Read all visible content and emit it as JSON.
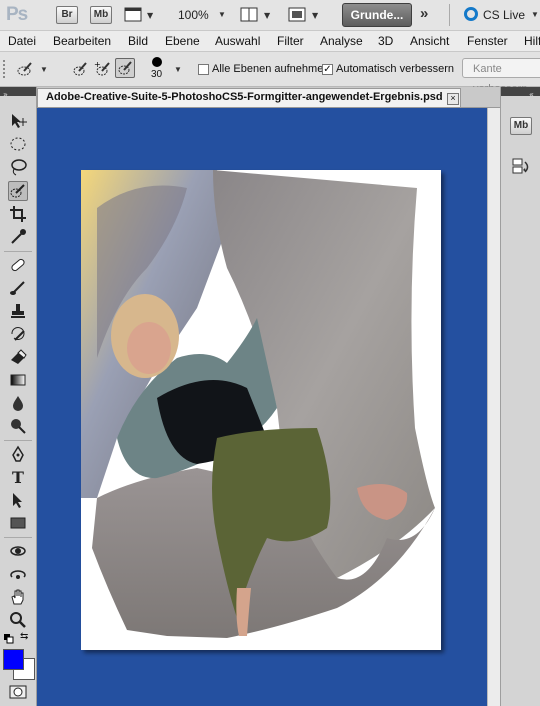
{
  "app": {
    "logo": "Ps",
    "bridge_label": "Br",
    "minibridge_label": "Mb",
    "zoom": "100%",
    "workspace_label": "Grunde...",
    "cslive_label": "CS Live"
  },
  "menu": [
    "Datei",
    "Bearbeiten",
    "Bild",
    "Ebene",
    "Auswahl",
    "Filter",
    "Analyse",
    "3D",
    "Ansicht",
    "Fenster",
    "Hilfe"
  ],
  "options": {
    "brush_size": "30",
    "sample_all_layers": "Alle Ebenen aufnehmen",
    "sample_all_layers_checked": false,
    "auto_enhance": "Automatisch verbessern",
    "auto_enhance_checked": true,
    "refine_edge": "Kante verbessern"
  },
  "document": {
    "tab_title": "Adobe-Creative-Suite-5-PhotoshoCS5-Formgitter-angewendet-Ergebnis.psd",
    "close_symbol": "×"
  },
  "colors": {
    "foreground": "#0000ff",
    "background": "#ffffff",
    "canvas_bg": "#2450a0"
  },
  "right_dock": {
    "minibridge_label": "Mb"
  }
}
